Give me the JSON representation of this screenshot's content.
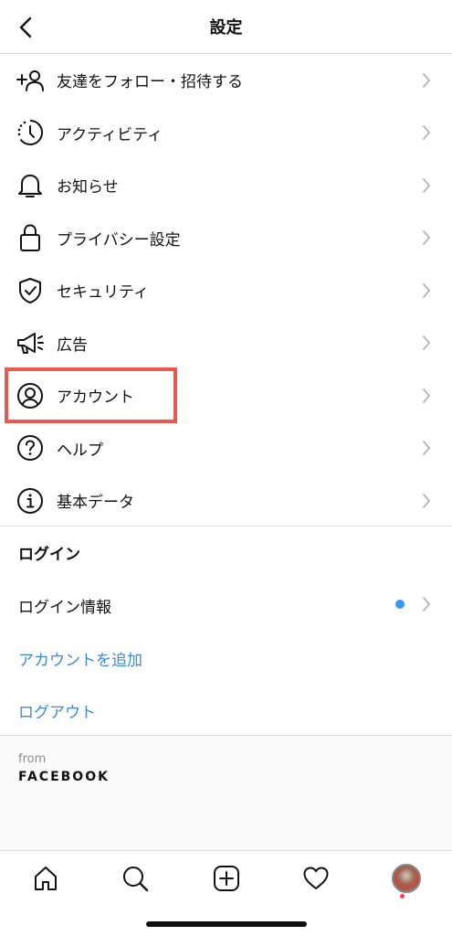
{
  "header": {
    "title": "設定",
    "back_icon": "chevron-left-icon"
  },
  "menu": {
    "items": [
      {
        "label": "友達をフォロー・招待する",
        "icon": "add-person-icon"
      },
      {
        "label": "アクティビティ",
        "icon": "activity-clock-icon"
      },
      {
        "label": "お知らせ",
        "icon": "bell-icon"
      },
      {
        "label": "プライバシー設定",
        "icon": "lock-icon"
      },
      {
        "label": "セキュリティ",
        "icon": "shield-check-icon"
      },
      {
        "label": "広告",
        "icon": "megaphone-icon"
      },
      {
        "label": "アカウント",
        "icon": "account-circle-icon",
        "highlighted": true
      },
      {
        "label": "ヘルプ",
        "icon": "help-circle-icon"
      },
      {
        "label": "基本データ",
        "icon": "info-circle-icon"
      }
    ]
  },
  "login_section": {
    "heading": "ログイン",
    "login_info": "ログイン情報",
    "add_account": "アカウントを追加",
    "logout": "ログアウト"
  },
  "footer": {
    "from": "from",
    "brand": "FACEBOOK"
  },
  "tabbar": {
    "tabs": [
      "home-icon",
      "search-icon",
      "new-post-icon",
      "heart-icon",
      "profile-avatar"
    ]
  },
  "colors": {
    "link": "#3d8ad1",
    "highlight": "#e85a4f",
    "notification_dot": "#3897f0"
  }
}
